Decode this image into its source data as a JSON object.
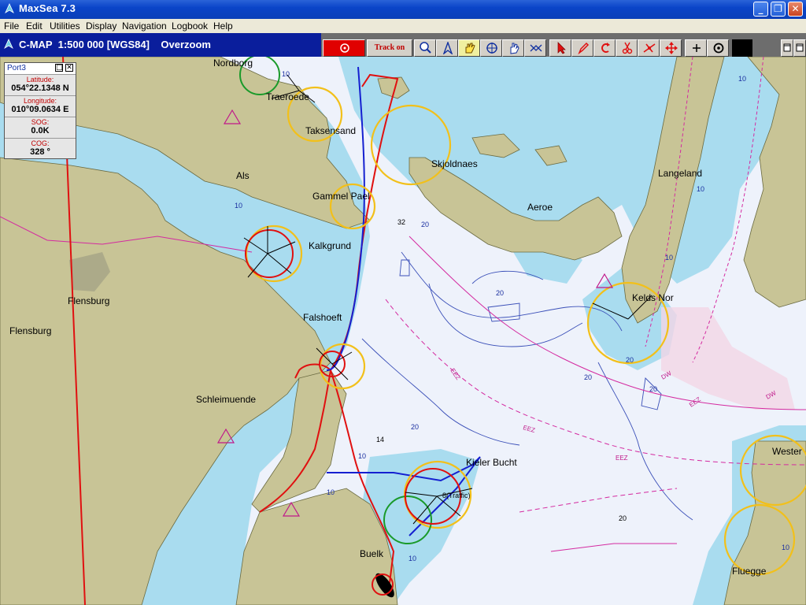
{
  "window": {
    "title": "MaxSea 7.3"
  },
  "menu": [
    "File",
    "Edit",
    "Utilities",
    "Display",
    "Navigation",
    "Logbook",
    "Help"
  ],
  "chart_bar": {
    "info": "C-MAP  1:500 000 [WGS84]    Overzoom"
  },
  "toolbar": {
    "track_on_label": "Track on",
    "tools": [
      "stop-icon",
      "track-on",
      "magnifier-icon",
      "compass-icon",
      "hand-move-icon",
      "target-icon",
      "hand-select-icon",
      "route-icon",
      "cursor-icon",
      "pencil-icon",
      "undo-icon",
      "scissors-icon",
      "wind-icon",
      "pan-arrows-icon",
      "crosshair-icon",
      "circle-target-icon"
    ]
  },
  "port_panel": {
    "title": "Port3",
    "rows": [
      {
        "label": "Latitude:",
        "value": "054°22.1348 N"
      },
      {
        "label": "Longitude:",
        "value": "010°09.0634 E"
      },
      {
        "label": "SOG:",
        "value": "0.0K"
      },
      {
        "label": "COG:",
        "value": "328 °"
      }
    ]
  },
  "map": {
    "places": {
      "nordborg": "Nordborg",
      "traeroede": "Traeroede",
      "taksensand": "Taksensand",
      "als": "Als",
      "skjoldnaes": "Skjoldnaes",
      "langeland": "Langeland",
      "aeroe": "Aeroe",
      "gammel_pael": "Gammel Pael",
      "kalkgrund": "Kalkgrund",
      "flensburg_a": "Flensburg",
      "flensburg_b": "Flensburg",
      "keldsnor": "Kelds Nor",
      "falshoeft": "Falshoeft",
      "schleimuende": "Schleimuende",
      "kieler_bucht": "Kieler Bucht",
      "traffic": "8(Traffic)",
      "wester": "Wester",
      "buelk": "Buelk",
      "fluegge": "Fluegge"
    },
    "soundings": {
      "s32": "32",
      "s14": "14",
      "s20": "20"
    },
    "depth_labels": [
      "10",
      "10",
      "10",
      "10",
      "20",
      "20",
      "20",
      "20",
      "20",
      "10",
      "10",
      "10",
      "10",
      "20",
      "10"
    ],
    "zone_labels": {
      "eez": "EEZ",
      "dw": "DW"
    },
    "colors": {
      "land": "#c8c496",
      "deep_water": "#eef2fb",
      "shallow_water": "#a9dcef",
      "track_red": "#e01010",
      "track_blue": "#1520d0",
      "contour": "#3a4fb8",
      "zone": "#d42aa0",
      "light_ring": "#f2c01a"
    }
  }
}
